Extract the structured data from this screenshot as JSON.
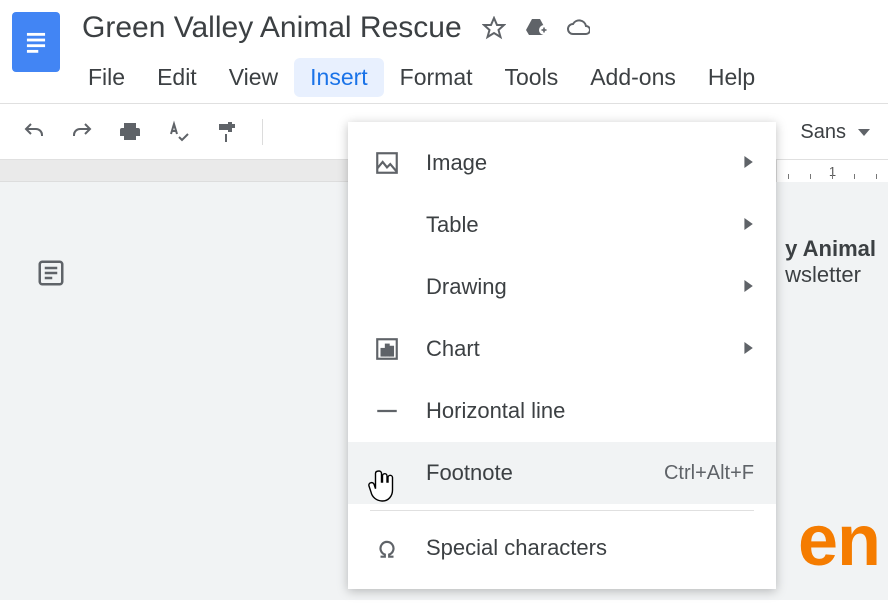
{
  "header": {
    "title": "Green Valley Animal Rescue"
  },
  "menubar": {
    "items": [
      "File",
      "Edit",
      "View",
      "Insert",
      "Format",
      "Tools",
      "Add-ons",
      "Help"
    ],
    "active_index": 3
  },
  "toolbar": {
    "font_name": "Sans"
  },
  "ruler": {
    "visible_label": "1"
  },
  "dropdown": {
    "items": [
      {
        "label": "Image",
        "has_submenu": true,
        "icon": "image"
      },
      {
        "label": "Table",
        "has_submenu": true,
        "icon": "table"
      },
      {
        "label": "Drawing",
        "has_submenu": true,
        "icon": "drawing"
      },
      {
        "label": "Chart",
        "has_submenu": true,
        "icon": "chart"
      },
      {
        "label": "Horizontal line",
        "icon": "hr"
      },
      {
        "label": "Footnote",
        "shortcut": "Ctrl+Alt+F",
        "icon": "footnote",
        "hovered": true
      },
      {
        "label": "Special characters",
        "icon": "omega"
      }
    ]
  },
  "document": {
    "visible_heading_fragment": "y Animal",
    "visible_subheading_fragment": "wsletter",
    "orange_fragment": "en"
  }
}
